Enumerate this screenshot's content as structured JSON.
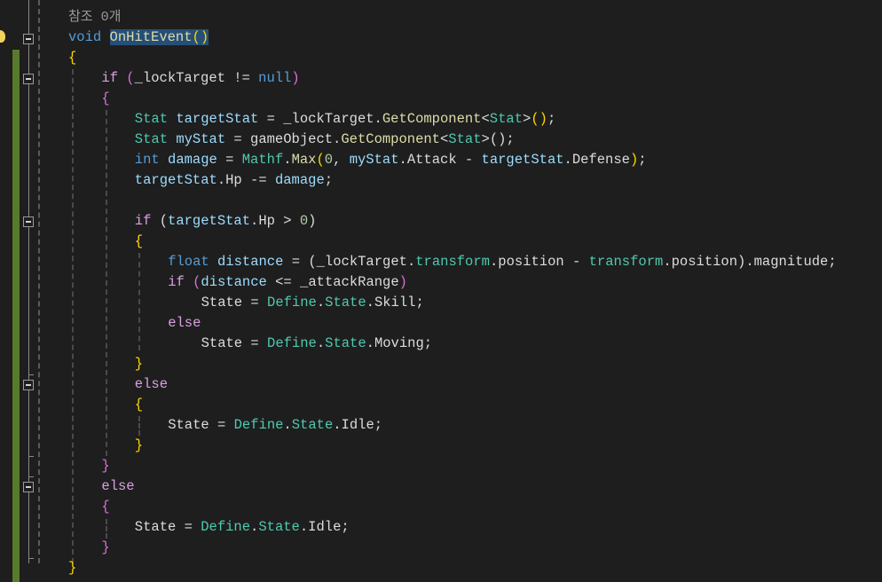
{
  "editor": {
    "codelens": "참조 0개",
    "indent_chars": 4,
    "lines": [
      {
        "indent": 0,
        "tokens": [
          [
            "void ",
            "kw"
          ],
          [
            "OnHitEvent",
            "meth sel"
          ],
          [
            "()",
            "br1 sel"
          ]
        ]
      },
      {
        "indent": 0,
        "tokens": [
          [
            "{",
            "br1"
          ]
        ]
      },
      {
        "indent": 1,
        "tokens": [
          [
            "if ",
            "ctl"
          ],
          [
            "(",
            "br2"
          ],
          [
            "_lockTarget != ",
            "def"
          ],
          [
            "null",
            "kw"
          ],
          [
            ")",
            "br2"
          ]
        ]
      },
      {
        "indent": 1,
        "tokens": [
          [
            "{",
            "br2"
          ]
        ]
      },
      {
        "indent": 2,
        "tokens": [
          [
            "Stat ",
            "type"
          ],
          [
            "targetStat",
            "var"
          ],
          [
            " = _lockTarget.",
            "def"
          ],
          [
            "GetComponent",
            "meth"
          ],
          [
            "<",
            "def"
          ],
          [
            "Stat",
            "type"
          ],
          [
            ">",
            "def"
          ],
          [
            "()",
            "br1"
          ],
          [
            ";",
            "def"
          ]
        ]
      },
      {
        "indent": 2,
        "tokens": [
          [
            "Stat ",
            "type"
          ],
          [
            "myStat",
            "var"
          ],
          [
            " = gameObject.",
            "def"
          ],
          [
            "GetComponent",
            "meth"
          ],
          [
            "<",
            "def"
          ],
          [
            "Stat",
            "type"
          ],
          [
            ">();",
            "def"
          ]
        ]
      },
      {
        "indent": 2,
        "tokens": [
          [
            "int ",
            "kw"
          ],
          [
            "damage",
            "var"
          ],
          [
            " = ",
            "def"
          ],
          [
            "Mathf",
            "type"
          ],
          [
            ".",
            "def"
          ],
          [
            "Max",
            "meth"
          ],
          [
            "(",
            "br1"
          ],
          [
            "0",
            "num"
          ],
          [
            ", ",
            "def"
          ],
          [
            "myStat",
            "var"
          ],
          [
            ".Attack - ",
            "def"
          ],
          [
            "targetStat",
            "var"
          ],
          [
            ".Defense",
            "def"
          ],
          [
            ")",
            "br1"
          ],
          [
            ";",
            "def"
          ]
        ]
      },
      {
        "indent": 2,
        "tokens": [
          [
            "targetStat",
            "var"
          ],
          [
            ".Hp -= ",
            "def"
          ],
          [
            "damage",
            "var"
          ],
          [
            ";",
            "def"
          ]
        ]
      },
      {
        "indent": 2,
        "tokens": []
      },
      {
        "indent": 2,
        "tokens": [
          [
            "if ",
            "ctl"
          ],
          [
            "(",
            "def"
          ],
          [
            "targetStat",
            "var"
          ],
          [
            ".Hp > ",
            "def"
          ],
          [
            "0",
            "num"
          ],
          [
            ")",
            "def"
          ]
        ]
      },
      {
        "indent": 2,
        "tokens": [
          [
            "{",
            "br1"
          ]
        ]
      },
      {
        "indent": 3,
        "tokens": [
          [
            "float ",
            "kw"
          ],
          [
            "distance",
            "var"
          ],
          [
            " = (_lockTarget.",
            "def"
          ],
          [
            "transform",
            "type"
          ],
          [
            ".position - ",
            "def"
          ],
          [
            "transform",
            "type"
          ],
          [
            ".position).magnitude;",
            "def"
          ]
        ]
      },
      {
        "indent": 3,
        "tokens": [
          [
            "if ",
            "ctl"
          ],
          [
            "(",
            "br2"
          ],
          [
            "distance",
            "var"
          ],
          [
            " <= _attackRange",
            "def"
          ],
          [
            ")",
            "br2"
          ],
          [
            "",
            "def"
          ]
        ]
      },
      {
        "indent": 4,
        "tokens": [
          [
            "State = ",
            "def"
          ],
          [
            "Define",
            "type"
          ],
          [
            ".",
            "def"
          ],
          [
            "State",
            "type"
          ],
          [
            ".Skill;",
            "def"
          ]
        ]
      },
      {
        "indent": 3,
        "tokens": [
          [
            "else",
            "ctl"
          ]
        ]
      },
      {
        "indent": 4,
        "tokens": [
          [
            "State = ",
            "def"
          ],
          [
            "Define",
            "type"
          ],
          [
            ".",
            "def"
          ],
          [
            "State",
            "type"
          ],
          [
            ".Moving;",
            "def"
          ]
        ]
      },
      {
        "indent": 2,
        "tokens": [
          [
            "}",
            "br1"
          ]
        ]
      },
      {
        "indent": 2,
        "tokens": [
          [
            "else",
            "ctl"
          ]
        ]
      },
      {
        "indent": 2,
        "tokens": [
          [
            "{",
            "br1"
          ]
        ]
      },
      {
        "indent": 3,
        "tokens": [
          [
            "State = ",
            "def"
          ],
          [
            "Define",
            "type"
          ],
          [
            ".",
            "def"
          ],
          [
            "State",
            "type"
          ],
          [
            ".Idle;",
            "def"
          ]
        ]
      },
      {
        "indent": 2,
        "tokens": [
          [
            "}",
            "br1"
          ]
        ]
      },
      {
        "indent": 1,
        "tokens": [
          [
            "}",
            "br2"
          ]
        ]
      },
      {
        "indent": 1,
        "tokens": [
          [
            "else",
            "ctl"
          ]
        ]
      },
      {
        "indent": 1,
        "tokens": [
          [
            "{",
            "br2"
          ]
        ]
      },
      {
        "indent": 2,
        "tokens": [
          [
            "State = ",
            "def"
          ],
          [
            "Define",
            "type"
          ],
          [
            ".",
            "def"
          ],
          [
            "State",
            "type"
          ],
          [
            ".Idle;",
            "def"
          ]
        ]
      },
      {
        "indent": 1,
        "tokens": [
          [
            "}",
            "br2"
          ]
        ]
      },
      {
        "indent": 0,
        "tokens": [
          [
            "}",
            "br1"
          ]
        ]
      }
    ]
  }
}
